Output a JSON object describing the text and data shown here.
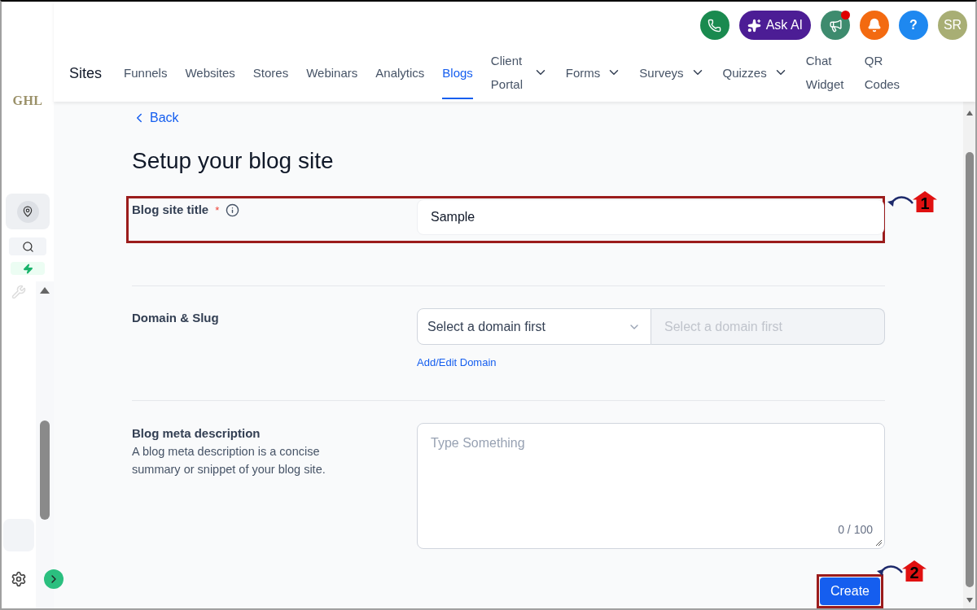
{
  "sidebar": {
    "logo": "GHL"
  },
  "header": {
    "ask_ai": "Ask AI",
    "avatar": "SR",
    "help": "?",
    "megaphone_unread": true
  },
  "nav": {
    "title": "Sites",
    "tabs": [
      {
        "label": "Funnels",
        "selected": false,
        "dropdown": false
      },
      {
        "label": "Websites",
        "selected": false,
        "dropdown": false
      },
      {
        "label": "Stores",
        "selected": false,
        "dropdown": false
      },
      {
        "label": "Webinars",
        "selected": false,
        "dropdown": false
      },
      {
        "label": "Analytics",
        "selected": false,
        "dropdown": false
      },
      {
        "label": "Blogs",
        "selected": true,
        "dropdown": false
      },
      {
        "label": "Client Portal",
        "selected": false,
        "dropdown": true
      },
      {
        "label": "Forms",
        "selected": false,
        "dropdown": true
      },
      {
        "label": "Surveys",
        "selected": false,
        "dropdown": true
      },
      {
        "label": "Quizzes",
        "selected": false,
        "dropdown": true
      },
      {
        "label": "Chat Widget",
        "selected": false,
        "dropdown": false
      },
      {
        "label": "QR Codes",
        "selected": false,
        "dropdown": false
      }
    ]
  },
  "back": "Back",
  "heading": "Setup your blog site",
  "fields": [
    {
      "kind": "text",
      "label": "Blog site title",
      "required_mark": "*",
      "info": true,
      "value": "Sample",
      "annotation": "1"
    },
    {
      "kind": "domain",
      "label": "Domain & Slug",
      "select_placeholder": "Select a domain first",
      "slug_placeholder": "Select a domain first",
      "link": "Add/Edit Domain"
    },
    {
      "kind": "textarea",
      "label": "Blog meta description",
      "description": "A blog meta description is a concise summary or snippet of your blog site.",
      "placeholder": "Type Something",
      "counter": "0 / 100"
    }
  ],
  "create": {
    "label": "Create",
    "annotation": "2"
  }
}
